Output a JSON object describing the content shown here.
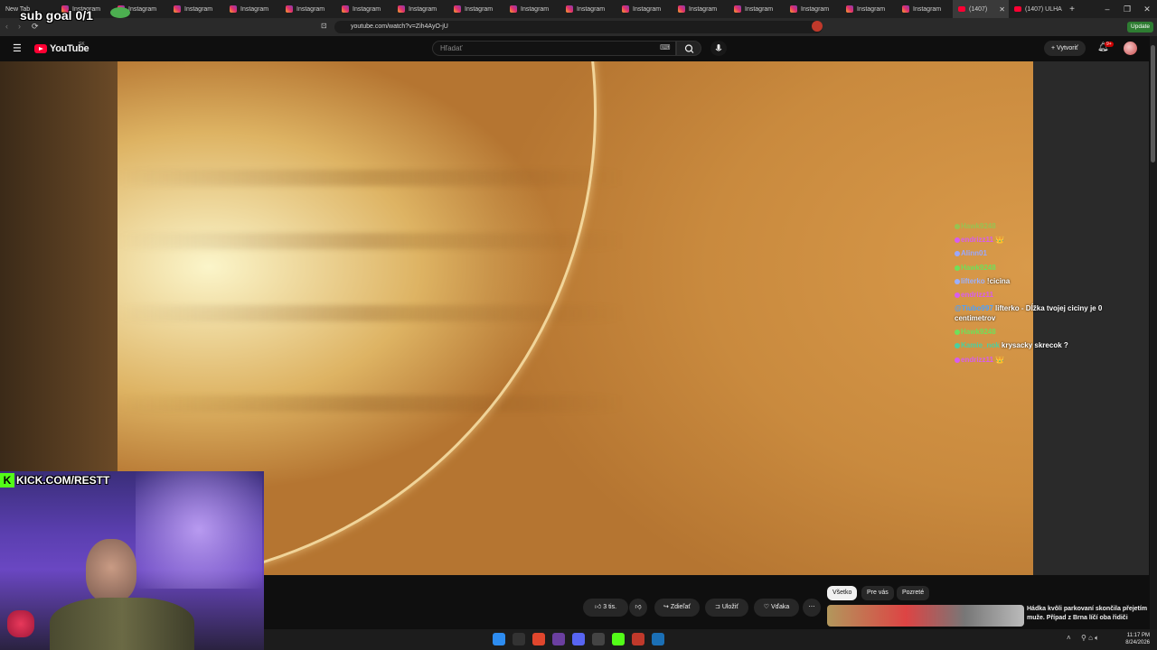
{
  "browser": {
    "tabs": [
      {
        "label": "New Tab",
        "icon": "blank"
      },
      {
        "label": "Instagram",
        "icon": "instagram"
      },
      {
        "label": "Instagram",
        "icon": "instagram"
      },
      {
        "label": "Instagram",
        "icon": "instagram"
      },
      {
        "label": "Instagram",
        "icon": "instagram"
      },
      {
        "label": "Instagram",
        "icon": "instagram"
      },
      {
        "label": "Instagram",
        "icon": "instagram"
      },
      {
        "label": "Instagram",
        "icon": "instagram"
      },
      {
        "label": "Instagram",
        "icon": "instagram"
      },
      {
        "label": "Instagram",
        "icon": "instagram"
      },
      {
        "label": "Instagram",
        "icon": "instagram"
      },
      {
        "label": "Instagram",
        "icon": "instagram"
      },
      {
        "label": "Instagram",
        "icon": "instagram"
      },
      {
        "label": "Instagram",
        "icon": "instagram"
      },
      {
        "label": "Instagram",
        "icon": "instagram"
      },
      {
        "label": "Instagram",
        "icon": "instagram"
      },
      {
        "label": "Instagram",
        "icon": "instagram"
      }
    ],
    "active_tab": "(1407)",
    "last_tab": "(1407) ULHA",
    "url": "youtube.com/watch?v=Zih4AyO-jU",
    "update_label": "Update"
  },
  "overlay": {
    "sub_goal": "sub goal 0/1",
    "kick_url": "KICK.COM/RESTT",
    "kick_letter": "K"
  },
  "youtube": {
    "logo_text": "YouTube",
    "region": "SK",
    "search_placeholder": "Hľadať",
    "create_label": "Vytvoriť",
    "notif_count": "9+",
    "like_count": "3 tis.",
    "share_label": "Zdieľať",
    "save_label": "Uložiť",
    "thanks_label": "Vďaka",
    "chips": [
      "Všetko",
      "Pre vás",
      "Pozreté"
    ],
    "recommended_title": "Hádka kvôli parkovaní skončila přejetím muže. Případ z Brna líčí oba řidiči"
  },
  "chat": [
    {
      "user": "Hawk9248",
      "msg": "",
      "color": "#6fe05a"
    },
    {
      "user": "endrizz11",
      "msg": "",
      "color": "#d85cf0"
    },
    {
      "user": "Alinn01",
      "msg": "",
      "color": "#9aa8ff"
    },
    {
      "user": "Hawk9248",
      "msg": "",
      "color": "#6fe05a"
    },
    {
      "user": "lifterko",
      "msg": "!cicina",
      "color": "#9ab0ff"
    },
    {
      "user": "endrizz11",
      "msg": "",
      "color": "#d85cf0"
    },
    {
      "user": "@Tiubo997",
      "msg": "lifterko - Dĺžka tvojej ciciny je 0 centimetrov",
      "color": "#4aa0ff",
      "wrap": true
    },
    {
      "user": "Hawk9248",
      "msg": "",
      "color": "#6fe05a"
    },
    {
      "user": "Kamie_nok",
      "msg": "krysacky skrecok ?",
      "color": "#4ad0a0"
    },
    {
      "user": "endrizz11",
      "msg": "",
      "color": "#d85cf0"
    }
  ],
  "clock": {
    "time": "11:17 PM",
    "date": "8/24/2026"
  },
  "colors": {
    "accent": "#ff0033",
    "kick": "#53fc18"
  }
}
